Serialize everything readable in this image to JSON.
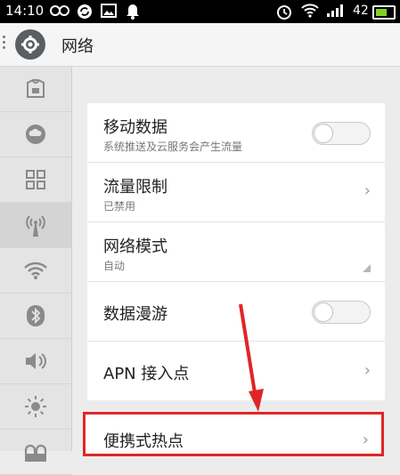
{
  "status_bar": {
    "time": "14:10",
    "battery_text": "42",
    "icons": [
      "infinity-icon",
      "sync-icon",
      "image-icon",
      "notification-icon",
      "alarm-icon",
      "wifi-icon",
      "signal-icon",
      "battery-icon"
    ]
  },
  "header": {
    "title": "网络"
  },
  "sidebar": {
    "items": [
      {
        "icon": "theme-icon"
      },
      {
        "icon": "cloud-icon"
      },
      {
        "icon": "apps-grid-icon"
      },
      {
        "icon": "network-icon",
        "active": true
      },
      {
        "icon": "wifi-icon"
      },
      {
        "icon": "bluetooth-icon"
      },
      {
        "icon": "volume-icon"
      },
      {
        "icon": "brightness-icon"
      },
      {
        "icon": "security-icon"
      }
    ]
  },
  "settings": {
    "mobile_data": {
      "title": "移动数据",
      "subtitle": "系统推送及云服务会产生流量",
      "enabled": false
    },
    "traffic_limit": {
      "title": "流量限制",
      "subtitle": "已禁用"
    },
    "network_mode": {
      "title": "网络模式",
      "subtitle": "自动"
    },
    "data_roaming": {
      "title": "数据漫游",
      "enabled": false
    },
    "apn": {
      "title": "APN 接入点"
    },
    "hotspot": {
      "title": "便携式热点"
    }
  },
  "chevron": "›",
  "colors": {
    "highlight": "#e02525",
    "battery": "#7ed321"
  }
}
